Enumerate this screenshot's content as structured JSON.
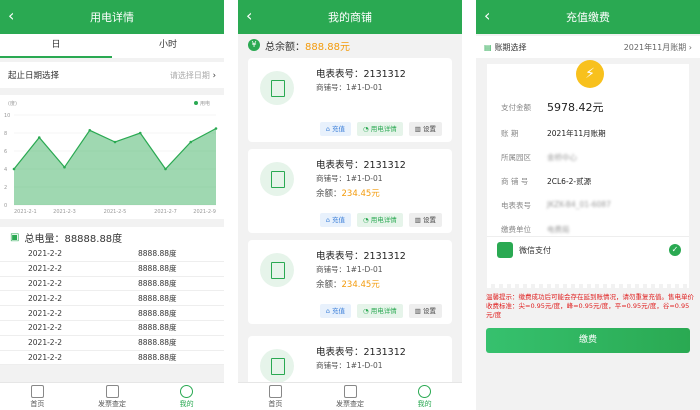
{
  "screen1": {
    "title": "用电详情",
    "tabs": [
      "日",
      "小时"
    ],
    "date_label": "起止日期选择",
    "date_placeholder": "请选择日期",
    "chart_data": {
      "type": "line",
      "unit_label": "(度)",
      "legend": "用电",
      "x": [
        "2021-2-1",
        "2021-2-2",
        "2021-2-3",
        "2021-2-4",
        "2021-2-5",
        "2021-2-6",
        "2021-2-7",
        "2021-2-8",
        "2021-2-9"
      ],
      "xticks": [
        "2021-2-1",
        "2021-2-3",
        "2021-2-5",
        "2021-2-7",
        "2021-2-9"
      ],
      "values": [
        4,
        7.5,
        4.2,
        8.3,
        7,
        8,
        4,
        7,
        8.5
      ],
      "ylim": [
        0,
        10
      ],
      "yticks": [
        0,
        2,
        4,
        6,
        8,
        10
      ],
      "color": "#2aa952"
    },
    "total_label": "总电量：88888.88度",
    "rows": [
      {
        "date": "2021-2-2",
        "value": "8888.88度"
      },
      {
        "date": "2021-2-2",
        "value": "8888.88度"
      },
      {
        "date": "2021-2-2",
        "value": "8888.88度"
      },
      {
        "date": "2021-2-2",
        "value": "8888.88度"
      },
      {
        "date": "2021-2-2",
        "value": "8888.88度"
      },
      {
        "date": "2021-2-2",
        "value": "8888.88度"
      },
      {
        "date": "2021-2-2",
        "value": "8888.88度"
      },
      {
        "date": "2021-2-2",
        "value": "8888.88度"
      }
    ]
  },
  "tabbar": [
    "首页",
    "发票查定",
    "我的"
  ],
  "screen2": {
    "title": "我的商铺",
    "balance_label": "总余额：",
    "balance_value": "888.88元",
    "cards": [
      {
        "meter": "电表表号：2131312",
        "shop": "商铺号：1#1-D-01",
        "balance_label": "",
        "balance": ""
      },
      {
        "meter": "电表表号：2131312",
        "shop": "商铺号：1#1-D-01",
        "balance_label": "余额：",
        "balance": "234.45元"
      },
      {
        "meter": "电表表号：2131312",
        "shop": "商铺号：1#1-D-01",
        "balance_label": "余额：",
        "balance": "234.45元"
      },
      {
        "meter": "电表表号：2131312",
        "shop": "商铺号：1#1-D-01",
        "balance_label": "",
        "balance": ""
      }
    ],
    "btn_recharge": "充值",
    "btn_detail": "用电详情",
    "btn_settings": "设置"
  },
  "screen3": {
    "title": "充值缴费",
    "period_label": "账期选择",
    "period_value": "2021年11月账期",
    "fields": [
      {
        "label": "支付金额",
        "value": "5978.42元"
      },
      {
        "label": "账      期",
        "value": "2021年11月账期"
      },
      {
        "label": "所属园区",
        "value": "金桥中心"
      },
      {
        "label": "商 铺 号",
        "value": "2CL6-2-贰源"
      },
      {
        "label": "电表表号",
        "value": "JKZK-B4_01-6087"
      },
      {
        "label": "缴费单位",
        "value": "电费局"
      }
    ],
    "pay_method": "微信支付",
    "notice": "温馨提示：缴费成功后可能会存在延到账情况，请勿重复充值。售电单价收费标准：尖=0.95元/度，峰=0.95元/度，平=0.95元/度，谷=0.95元/度",
    "pay_button": "缴费"
  }
}
